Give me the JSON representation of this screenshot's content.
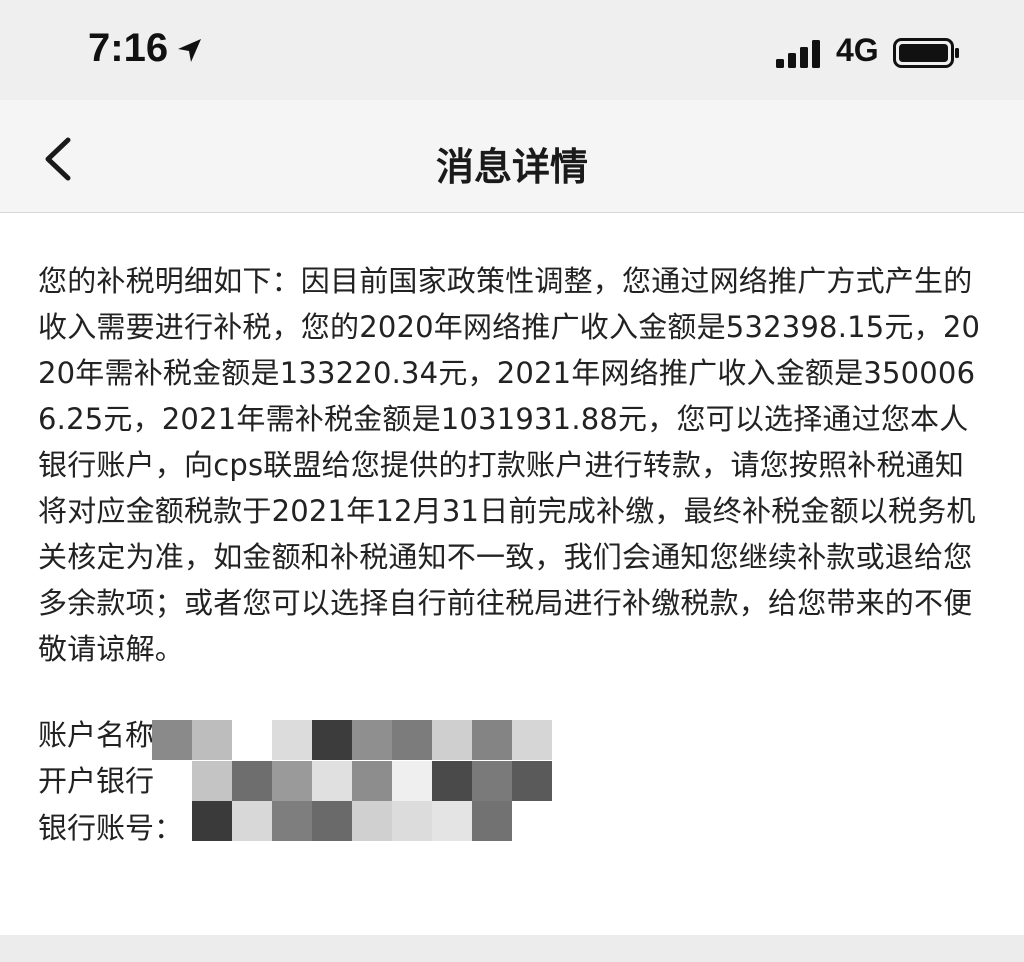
{
  "status_bar": {
    "time": "7:16",
    "network": "4G",
    "icons": [
      "location-arrow-icon",
      "signal-bars-icon",
      "battery-icon"
    ]
  },
  "nav": {
    "title": "消息详情",
    "back_icon": "chevron-left-icon"
  },
  "message": {
    "body": "您的补税明细如下：因目前国家政策性调整，您通过网络推广方式产生的收入需要进行补税，您的2020年网络推广收入金额是532398.15元，2020年需补税金额是133220.34元，2021年网络推广收入金额是3500066.25元，2021年需补税金额是1031931.88元，您可以选择通过您本人银行账户，向cps联盟给您提供的打款账户进行转款，请您按照补税通知将对应金额税款于2021年12月31日前完成补缴，最终补税金额以税务机关核定为准，如金额和补税通知不一致，我们会通知您继续补款或退给您多余款项；或者您可以选择自行前往税局进行补缴税款，给您带来的不便敬请谅解。"
  },
  "account": {
    "name_label": "账户名称",
    "bank_label": "开户银行",
    "number_label": "银行账号："
  }
}
